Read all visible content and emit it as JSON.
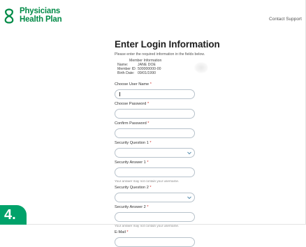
{
  "header": {
    "logo_line1": "Physicians",
    "logo_line2": "Health Plan",
    "contact_label": "Contact Support"
  },
  "form": {
    "title": "Enter Login Information",
    "subtitle": "Please enter the required information in the fields below.",
    "member": {
      "heading": "Member Information",
      "name_label": "Name:",
      "name_value": "JANE DOE",
      "id_label": "Member ID:",
      "id_value": "500000000-00",
      "dob_label": "Birth Date:",
      "dob_value": "09/01/1990"
    },
    "required_mark": "*",
    "fields": {
      "username_label": "Choose User Name",
      "password_label": "Choose Password",
      "confirm_password_label": "Confirm Password",
      "question1_label": "Security Question 1",
      "answer1_label": "Security Answer 1",
      "answer1_hint": "Your answer may not contain your username.",
      "question2_label": "Security Question 2",
      "answer2_label": "Security Answer 2",
      "answer2_hint": "Your answer may not contain your username.",
      "email_label": "E-Mail"
    }
  },
  "step_badge": "4.",
  "colors": {
    "brand_green": "#008a46",
    "badge_green": "#00a26a",
    "required_red": "#d0342c"
  },
  "icons": [
    "logo-mark-icon",
    "chevron-down-icon"
  ]
}
